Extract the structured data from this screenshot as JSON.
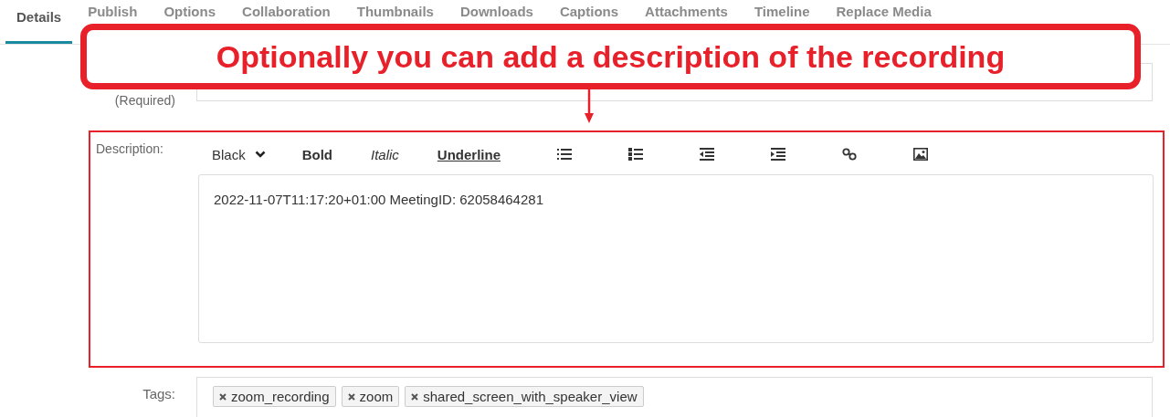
{
  "tabs": [
    {
      "label": "Details",
      "selected": true
    },
    {
      "label": "Publish",
      "selected": false
    },
    {
      "label": "Options",
      "selected": false
    },
    {
      "label": "Collaboration",
      "selected": false
    },
    {
      "label": "Thumbnails",
      "selected": false
    },
    {
      "label": "Downloads",
      "selected": false
    },
    {
      "label": "Captions",
      "selected": false
    },
    {
      "label": "Attachments",
      "selected": false
    },
    {
      "label": "Timeline",
      "selected": false
    },
    {
      "label": "Replace Media",
      "selected": false
    }
  ],
  "name_field": {
    "label": "(Required)"
  },
  "description": {
    "label": "Description:",
    "toolbar": [
      {
        "kind": "select",
        "label": "Black"
      },
      {
        "kind": "bold",
        "label": "Bold"
      },
      {
        "kind": "italic",
        "label": "Italic"
      },
      {
        "kind": "underline",
        "label": "Underline"
      }
    ],
    "value": "2022-11-07T11:17:20+01:00 MeetingID: 62058464281"
  },
  "tags": {
    "label": "Tags:",
    "items": [
      "zoom_recording",
      "zoom",
      "shared_screen_with_speaker_view"
    ]
  },
  "callout": {
    "text": "Optionally you can add a description of the recording"
  }
}
